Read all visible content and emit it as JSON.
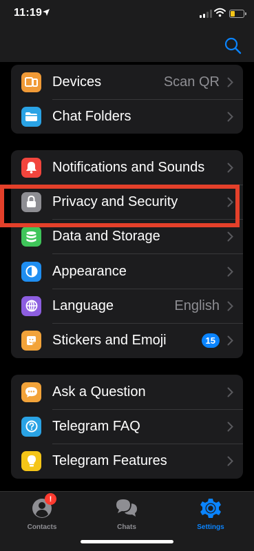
{
  "status_bar": {
    "time": "11:19",
    "icons": [
      "location-arrow-icon",
      "signal-icon",
      "wifi-icon",
      "battery-icon"
    ],
    "battery_color": "#f5c518"
  },
  "nav": {
    "search_icon": "search-icon",
    "accent": "#0a84ff"
  },
  "groups": [
    {
      "items": [
        {
          "label": "Devices",
          "value": "Scan QR",
          "icon": "devices-icon",
          "icon_color": "#f09a37"
        },
        {
          "label": "Chat Folders",
          "value": "",
          "icon": "folder-icon",
          "icon_color": "#2aa3e5"
        }
      ]
    },
    {
      "items": [
        {
          "label": "Notifications and Sounds",
          "value": "",
          "icon": "bell-icon",
          "icon_color": "#f2453d"
        },
        {
          "label": "Privacy and Security",
          "value": "",
          "icon": "lock-icon",
          "icon_color": "#8e8e93"
        },
        {
          "label": "Data and Storage",
          "value": "",
          "icon": "storage-icon",
          "icon_color": "#3fc55a"
        },
        {
          "label": "Appearance",
          "value": "",
          "icon": "appearance-icon",
          "icon_color": "#1f8ef1"
        },
        {
          "label": "Language",
          "value": "English",
          "icon": "globe-icon",
          "icon_color": "#8d5ee0"
        },
        {
          "label": "Stickers and Emoji",
          "value": "",
          "badge": "15",
          "icon": "sticker-icon",
          "icon_color": "#f2a33a"
        }
      ]
    },
    {
      "items": [
        {
          "label": "Ask a Question",
          "value": "",
          "icon": "chat-bubble-icon",
          "icon_color": "#f2a33a"
        },
        {
          "label": "Telegram FAQ",
          "value": "",
          "icon": "question-icon",
          "icon_color": "#2aa3e5"
        },
        {
          "label": "Telegram Features",
          "value": "",
          "icon": "lightbulb-icon",
          "icon_color": "#f5c518"
        }
      ]
    }
  ],
  "highlight_color": "#e4402a",
  "tabs": [
    {
      "label": "Contacts",
      "icon": "contacts-icon",
      "badge": "!",
      "active": false
    },
    {
      "label": "Chats",
      "icon": "chats-icon",
      "active": false
    },
    {
      "label": "Settings",
      "icon": "settings-gear-icon",
      "active": true
    }
  ]
}
